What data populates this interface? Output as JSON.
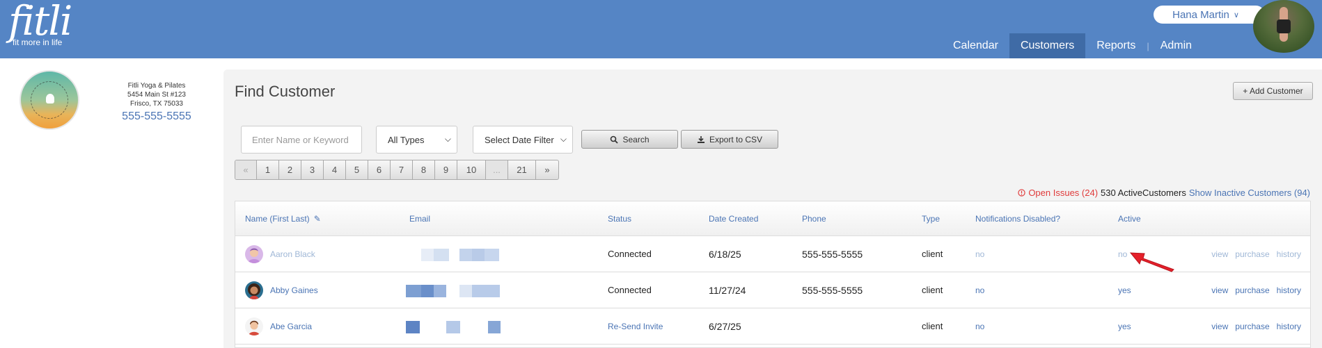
{
  "brand": {
    "name": "fitli",
    "tagline": "fit more in life"
  },
  "user": {
    "name": "Hana Martin"
  },
  "nav": [
    {
      "label": "Calendar",
      "active": false
    },
    {
      "label": "Customers",
      "active": true
    },
    {
      "label": "Reports",
      "active": false
    },
    {
      "label": "Admin",
      "active": false
    }
  ],
  "studio": {
    "name": "Fitli Yoga & Pilates",
    "address1": "5454 Main St #123",
    "address2": "Frisco, TX 75033",
    "phone": "555-555-5555"
  },
  "page": {
    "title": "Find Customer",
    "add_button": "+ Add Customer"
  },
  "filters": {
    "search_placeholder": "Enter Name or Keyword",
    "type_select": "All Types",
    "date_select": "Select Date Filter",
    "search_button": "Search",
    "export_button": "Export to CSV"
  },
  "pager": [
    "«",
    "1",
    "2",
    "3",
    "4",
    "5",
    "6",
    "7",
    "8",
    "9",
    "10",
    "...",
    "21",
    "»"
  ],
  "summary": {
    "issues": "Open Issues (24)",
    "active_count": "530 ActiveCustomers",
    "inactive_link": "Show Inactive Customers (94)"
  },
  "table": {
    "headers": {
      "name": "Name (First Last)",
      "email": "Email",
      "status": "Status",
      "date_created": "Date Created",
      "phone": "Phone",
      "type": "Type",
      "notifications": "Notifications Disabled?",
      "active": "Active"
    },
    "rows": [
      {
        "name": "Aaron Black",
        "status": "Connected",
        "date": "6/18/25",
        "phone": "555-555-5555",
        "type": "client",
        "notifications": "no",
        "active": "no",
        "dimmed": true
      },
      {
        "name": "Abby Gaines",
        "status": "Connected",
        "date": "11/27/24",
        "phone": "555-555-5555",
        "type": "client",
        "notifications": "no",
        "active": "yes",
        "dimmed": false
      },
      {
        "name": "Abe Garcia",
        "status": "Re-Send Invite",
        "date": "6/27/25",
        "phone": "",
        "type": "client",
        "notifications": "no",
        "active": "yes",
        "dimmed": false
      }
    ],
    "actions": {
      "view": "view",
      "purchase": "purchase",
      "history": "history"
    }
  },
  "colors": {
    "header_blue": "#5585c5",
    "active_nav": "#3f6ba6",
    "link": "#4a74b4",
    "alert": "#e03b3b"
  }
}
